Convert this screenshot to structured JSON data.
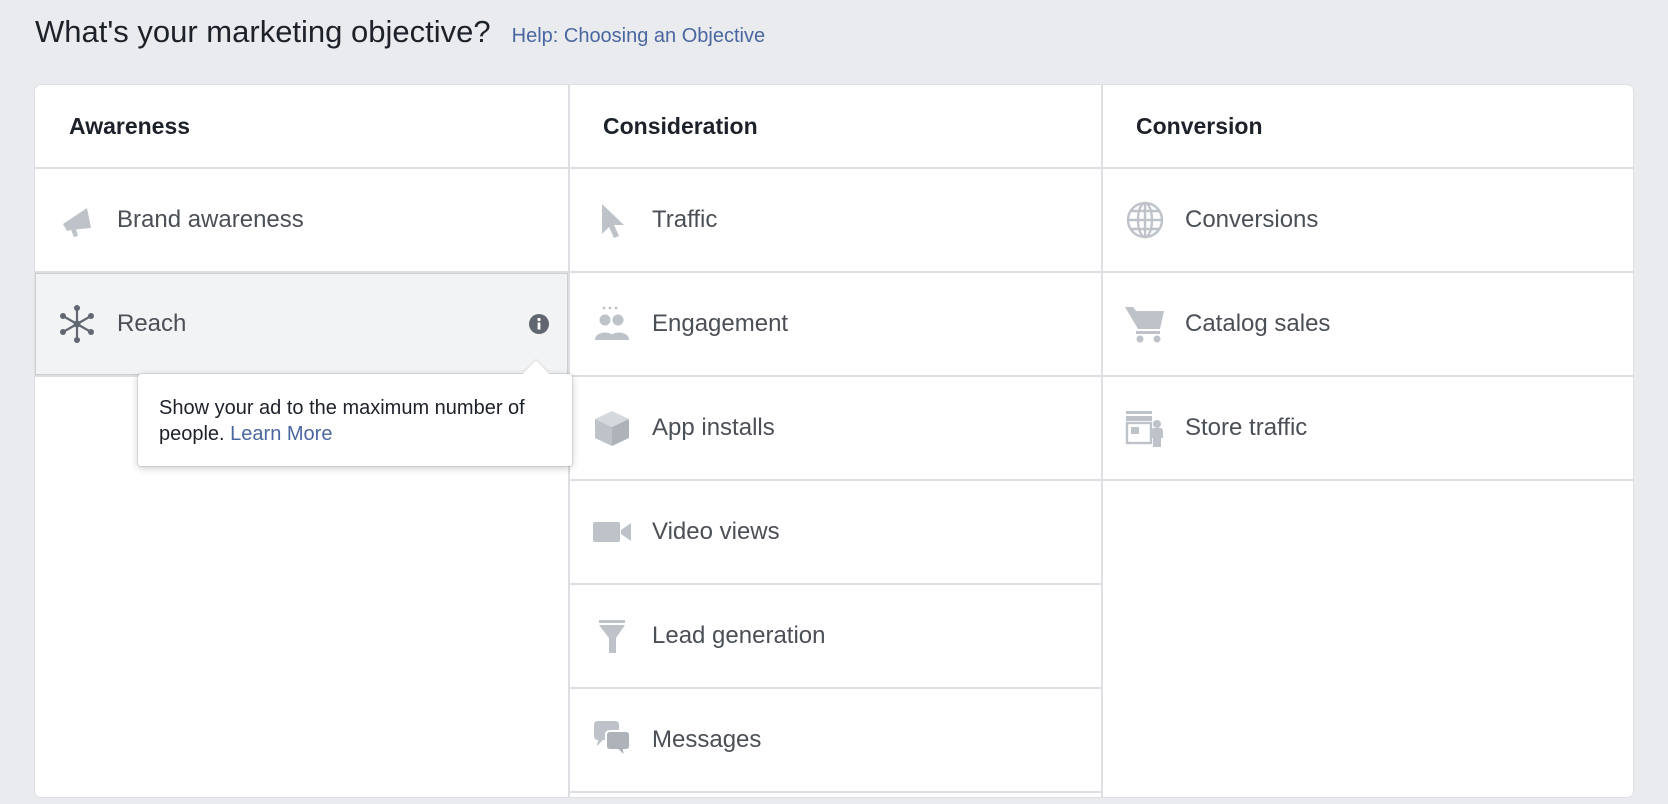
{
  "header": {
    "title": "What's your marketing objective?",
    "help_link": "Help: Choosing an Objective"
  },
  "columns": [
    {
      "heading": "Awareness",
      "items": [
        {
          "label": "Brand awareness",
          "icon": "megaphone-icon"
        },
        {
          "label": "Reach",
          "icon": "reach-icon",
          "selected": true
        }
      ]
    },
    {
      "heading": "Consideration",
      "items": [
        {
          "label": "Traffic",
          "icon": "cursor-icon"
        },
        {
          "label": "Engagement",
          "icon": "people-icon"
        },
        {
          "label": "App installs",
          "icon": "box-icon"
        },
        {
          "label": "Video views",
          "icon": "video-camera-icon"
        },
        {
          "label": "Lead generation",
          "icon": "funnel-icon"
        },
        {
          "label": "Messages",
          "icon": "chat-bubbles-icon"
        }
      ]
    },
    {
      "heading": "Conversion",
      "items": [
        {
          "label": "Conversions",
          "icon": "globe-icon"
        },
        {
          "label": "Catalog sales",
          "icon": "cart-icon"
        },
        {
          "label": "Store traffic",
          "icon": "store-icon"
        }
      ]
    }
  ],
  "tooltip": {
    "text": "Show your ad to the maximum number of people.",
    "link": "Learn More"
  },
  "colors": {
    "background": "#e9ebee",
    "panel": "#ffffff",
    "divider": "#dddfe2",
    "icon": "#bec3c9",
    "link": "#4b67a1",
    "selected_bg": "#f2f3f5",
    "text": "#4b4f56"
  }
}
